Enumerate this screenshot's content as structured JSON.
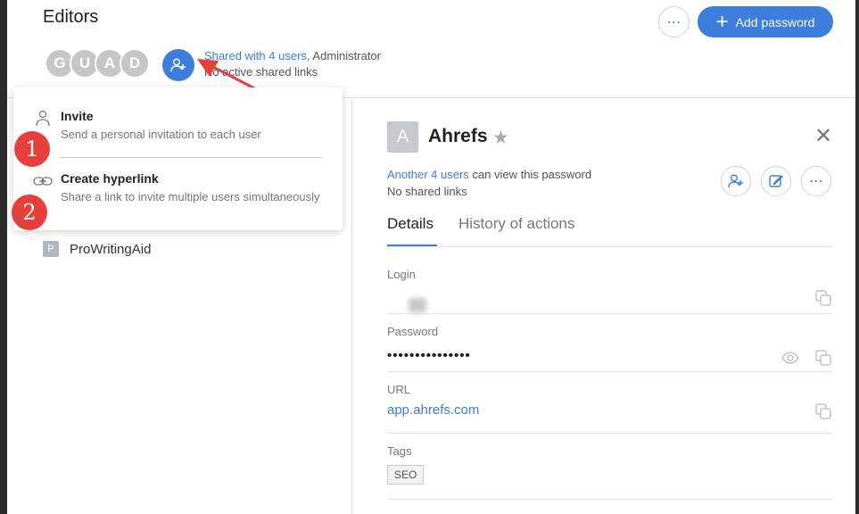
{
  "header": {
    "title": "Editors",
    "avatars": [
      "G",
      "U",
      "A",
      "D"
    ],
    "shared_link_text": "Shared with 4 users",
    "shared_role_text": ", Administrator",
    "shared_links_text": "No active shared links",
    "more_label": "⋯",
    "add_password_label": "Add password",
    "add_password_plus": "+"
  },
  "popup": {
    "items": [
      {
        "label": "Invite",
        "description": "Send a personal invitation to each user",
        "icon": "user-icon"
      },
      {
        "label": "Create hyperlink",
        "description": "Share a link to invite multiple users simultaneously",
        "icon": "link-icon"
      }
    ],
    "badges": [
      "1",
      "2"
    ]
  },
  "list": {
    "items": [
      {
        "tile": "P",
        "name": "ProWritingAid"
      }
    ]
  },
  "detail": {
    "tile": "A",
    "title": "Ahrefs",
    "star": "★",
    "close": "✕",
    "viewers_link": "Another 4 users",
    "viewers_rest": " can view this password",
    "shared_links": "No shared links",
    "more_label": "⋯",
    "tabs": [
      "Details",
      "History of actions"
    ],
    "fields": {
      "login_label": "Login",
      "password_label": "Password",
      "password_value": "•••••••••••••••",
      "url_label": "URL",
      "url_value": "app.ahrefs.com",
      "tags_label": "Tags",
      "tag_value": "SEO"
    }
  },
  "colors": {
    "accent": "#3d7ddb",
    "annotation": "#e5403c"
  }
}
